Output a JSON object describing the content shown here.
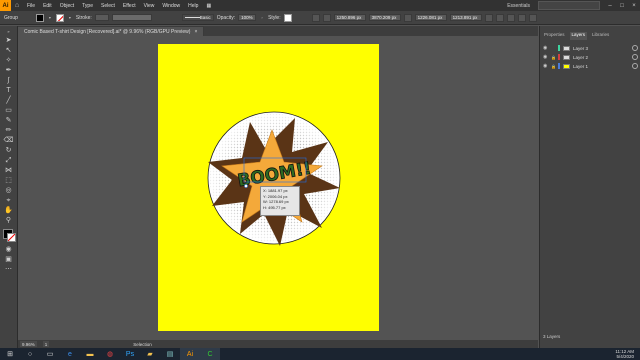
{
  "menubar": {
    "logo": "Ai",
    "items": [
      "File",
      "Edit",
      "Object",
      "Type",
      "Select",
      "Effect",
      "View",
      "Window",
      "Help"
    ],
    "workspace": "Essentials"
  },
  "controlbar": {
    "selection_label": "Group",
    "stroke_label": "Stroke:",
    "brush_label": "Basic",
    "opacity_label": "Opacity:",
    "opacity_value": "100%",
    "style_label": "Style:",
    "x_value": "1250.896 px",
    "y_value": "3870.209 px",
    "w_value": "1226.081 px",
    "h_value": "1213.891 px"
  },
  "document": {
    "tab_title": "Comic Based T-shirt Design [Recovered].ai* @ 9.96% (RGB/GPU Preview)",
    "close_glyph": "×"
  },
  "measure": {
    "x": "X: 1881.97 px",
    "y": "Y: 2006.04 px",
    "w": "W: 1278.69 px",
    "h": "H: 495.77 px"
  },
  "artwork": {
    "text": "BOOM!!",
    "colors": {
      "artboard": "#ffff00",
      "star_outer": "#5a3416",
      "star_inner": "#f4a93a",
      "circle": "#ffffff",
      "text": "#2e6b22"
    }
  },
  "rpanel": {
    "tabs": [
      "Properties",
      "Layers",
      "Libraries"
    ],
    "active_tab": "Layers",
    "layers": [
      {
        "name": "Layer 3",
        "color": "#3dd6a0"
      },
      {
        "name": "Layer 2",
        "color": "#d04040"
      },
      {
        "name": "Layer 1",
        "color": "#4a7bd8"
      }
    ],
    "footer": "3 Layers"
  },
  "statusbar": {
    "zoom": "9.96%",
    "page": "1",
    "mode": "Selection"
  },
  "taskbar": {
    "icons": [
      "windows-start",
      "search",
      "task-view",
      "edge",
      "file-explorer",
      "chrome",
      "photoshop",
      "folder",
      "notepad",
      "illustrator",
      "camtasia"
    ],
    "time": "11:12 AM",
    "date": "5/4/2020"
  }
}
